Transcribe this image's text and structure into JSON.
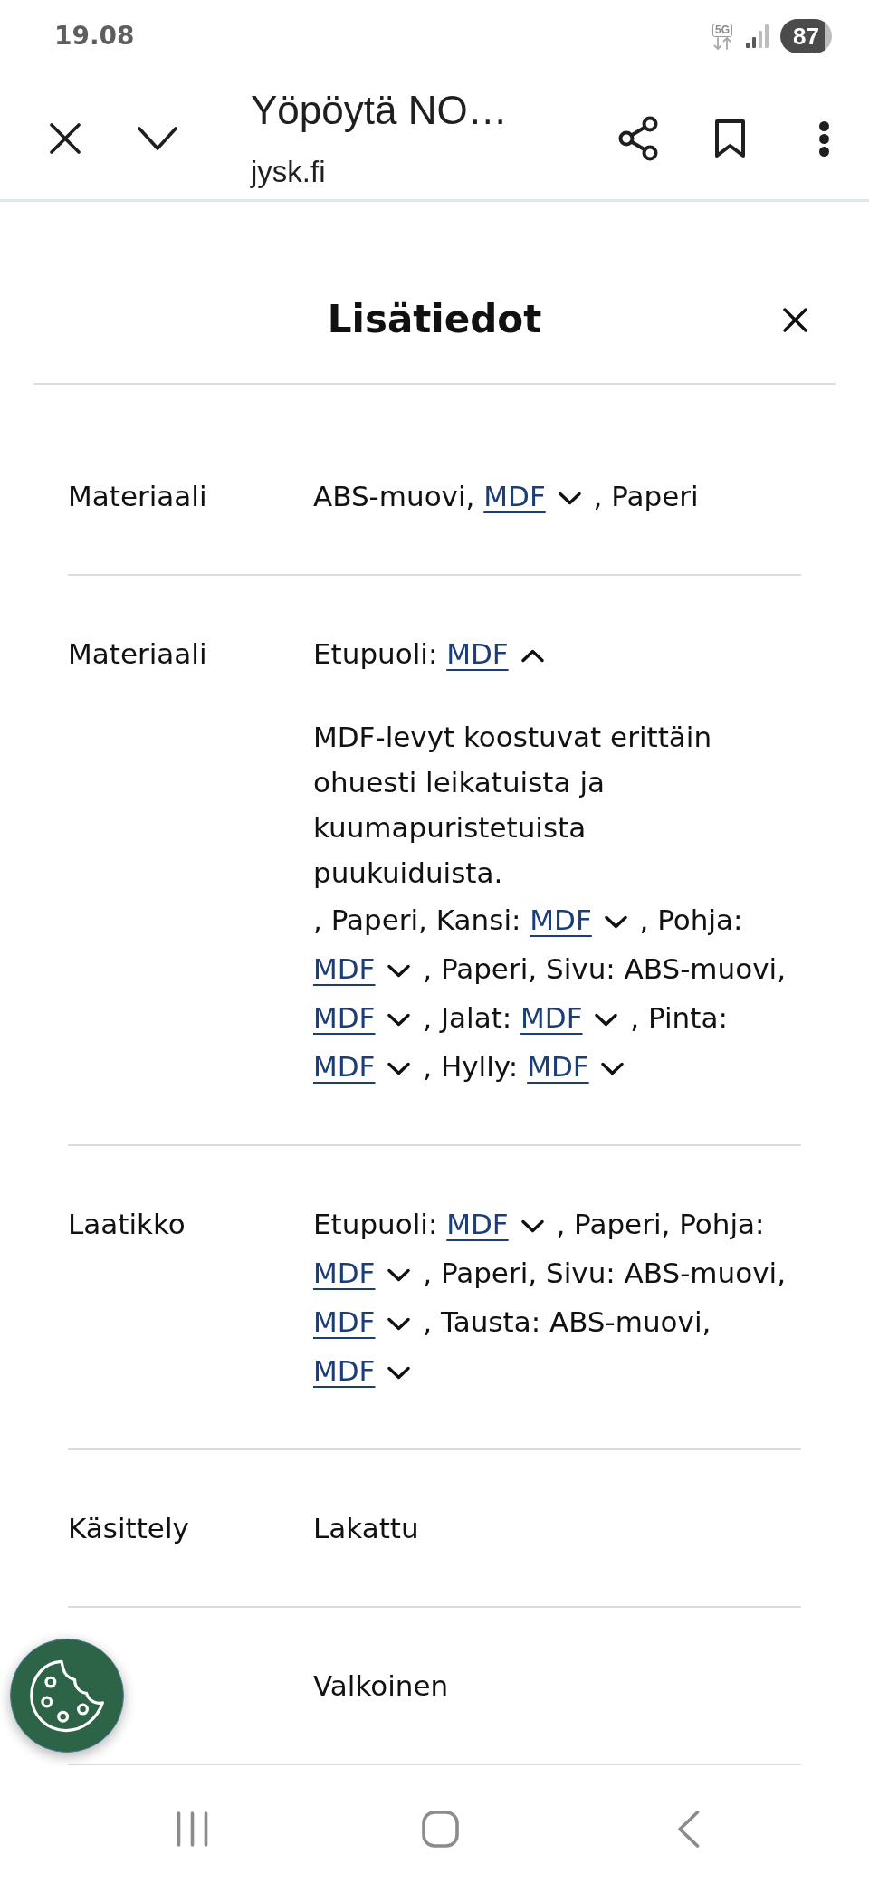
{
  "status_bar": {
    "time": "19.08",
    "network": "5G",
    "battery": "87"
  },
  "toolbar": {
    "title": "Yöpöytä NO…",
    "url": "jysk.fi"
  },
  "panel": {
    "title": "Lisätiedot",
    "rows": [
      {
        "label": "Materiaali",
        "segments": [
          {
            "kind": "text",
            "text": "ABS-muovi,"
          },
          {
            "kind": "link",
            "text": "MDF",
            "expanded": false
          },
          {
            "kind": "text",
            "text": ", Paperi"
          }
        ]
      },
      {
        "label": "Materiaali",
        "segments": [
          {
            "kind": "text",
            "text": "Etupuoli:"
          },
          {
            "kind": "link",
            "text": "MDF",
            "expanded": true,
            "description": "MDF-levyt koostuvat erittäin ohuesti leikatuista ja kuumapuristetuista puukuiduista."
          },
          {
            "kind": "text",
            "text": ", Paperi, Kansi:"
          },
          {
            "kind": "link",
            "text": "MDF",
            "expanded": false
          },
          {
            "kind": "text",
            "text": ", Pohja:"
          },
          {
            "kind": "link",
            "text": "MDF",
            "expanded": false
          },
          {
            "kind": "text",
            "text": ", Paperi, Sivu: ABS-muovi,"
          },
          {
            "kind": "link",
            "text": "MDF",
            "expanded": false
          },
          {
            "kind": "text",
            "text": ", Jalat:"
          },
          {
            "kind": "link",
            "text": "MDF",
            "expanded": false
          },
          {
            "kind": "text",
            "text": ", Pinta:"
          },
          {
            "kind": "link",
            "text": "MDF",
            "expanded": false
          },
          {
            "kind": "text",
            "text": ", Hylly:"
          },
          {
            "kind": "link",
            "text": "MDF",
            "expanded": false
          }
        ]
      },
      {
        "label": "Laatikko",
        "segments": [
          {
            "kind": "text",
            "text": "Etupuoli:"
          },
          {
            "kind": "link",
            "text": "MDF",
            "expanded": false
          },
          {
            "kind": "text",
            "text": ", Paperi, Pohja:"
          },
          {
            "kind": "link",
            "text": "MDF",
            "expanded": false
          },
          {
            "kind": "text",
            "text": ", Paperi, Sivu: ABS-muovi,"
          },
          {
            "kind": "link",
            "text": "MDF",
            "expanded": false
          },
          {
            "kind": "text",
            "text": ", Tausta: ABS-muovi,"
          },
          {
            "kind": "link",
            "text": "MDF",
            "expanded": false
          }
        ]
      },
      {
        "label": "Käsittely",
        "segments": [
          {
            "kind": "text",
            "text": "Lakattu"
          }
        ]
      },
      {
        "segments": [
          {
            "kind": "text",
            "text": "Valkoinen"
          }
        ]
      }
    ]
  }
}
